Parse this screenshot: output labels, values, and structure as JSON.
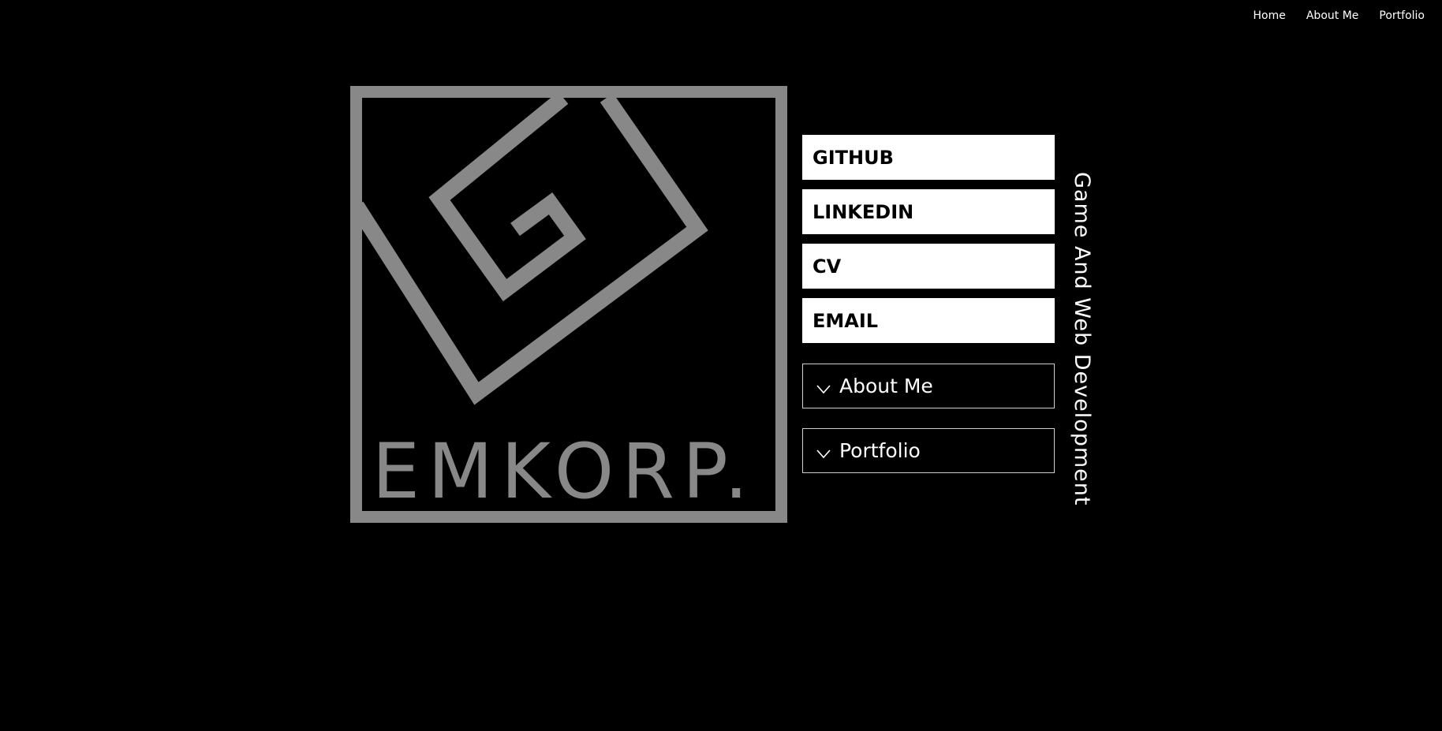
{
  "nav": {
    "items": [
      "Home",
      "About Me",
      "Portfolio"
    ]
  },
  "logo": {
    "wordmark": "EMKORP.",
    "color": "#888888"
  },
  "links": [
    {
      "label": "GITHUB"
    },
    {
      "label": "LINKEDIN"
    },
    {
      "label": "CV"
    },
    {
      "label": "EMAIL"
    }
  ],
  "sections": [
    {
      "label": "About Me",
      "icon": "chevron-down-icon"
    },
    {
      "label": "Portfolio",
      "icon": "chevron-down-icon"
    }
  ],
  "tagline": "Game And Web Development",
  "colors": {
    "background": "#000000",
    "text": "#ffffff",
    "logo": "#888888",
    "button_bg": "#ffffff",
    "button_text": "#000000"
  }
}
